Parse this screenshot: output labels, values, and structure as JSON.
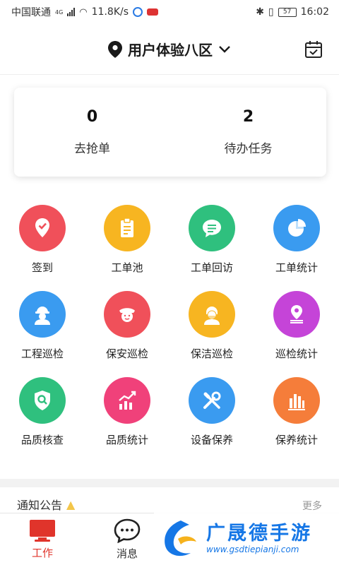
{
  "status_bar": {
    "carrier": "中国联通",
    "network": "4G",
    "speed": "11.8K/s",
    "battery": "57",
    "time": "16:02"
  },
  "header": {
    "location": "用户体验八区",
    "location_icon": "map-pin-icon",
    "calendar_icon": "calendar-check-icon"
  },
  "summary": [
    {
      "count": "0",
      "label": "去抢单"
    },
    {
      "count": "2",
      "label": "待办任务"
    }
  ],
  "grid": [
    {
      "label": "签到",
      "icon": "check-in-pin-icon",
      "color": "#f0505a"
    },
    {
      "label": "工单池",
      "icon": "clipboard-icon",
      "color": "#f7b521"
    },
    {
      "label": "工单回访",
      "icon": "chat-bubble-icon",
      "color": "#2fc07e"
    },
    {
      "label": "工单统计",
      "icon": "pie-chart-icon",
      "color": "#3a9bf0"
    },
    {
      "label": "工程巡检",
      "icon": "engineer-icon",
      "color": "#3a9bf0"
    },
    {
      "label": "保安巡检",
      "icon": "security-guard-icon",
      "color": "#f0505a"
    },
    {
      "label": "保洁巡检",
      "icon": "cleaner-icon",
      "color": "#f7b521"
    },
    {
      "label": "巡检统计",
      "icon": "route-pin-icon",
      "color": "#c544d8"
    },
    {
      "label": "品质核查",
      "icon": "shield-search-icon",
      "color": "#2fc07e"
    },
    {
      "label": "品质统计",
      "icon": "trend-chart-icon",
      "color": "#f0417a"
    },
    {
      "label": "设备保养",
      "icon": "tools-icon",
      "color": "#3a9bf0"
    },
    {
      "label": "保养统计",
      "icon": "bar-chart-icon",
      "color": "#f57d3a"
    }
  ],
  "notice": {
    "title": "通知公告",
    "more": "更多"
  },
  "tabs": [
    {
      "label": "工作",
      "icon": "monitor-icon"
    },
    {
      "label": "消息",
      "icon": "message-icon"
    }
  ],
  "watermark": {
    "title": "广晟德手游",
    "url": "www.gsdtiepianji.com"
  },
  "colors": {
    "accent_red": "#e0342b",
    "watermark_blue": "#1677e6"
  }
}
